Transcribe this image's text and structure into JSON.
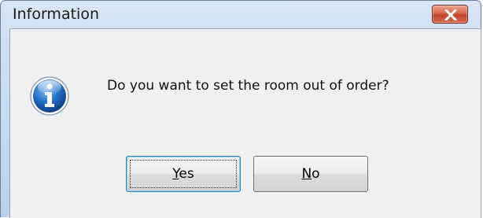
{
  "window": {
    "title": "Information"
  },
  "dialog": {
    "message": "Do you want to set the room out of order?",
    "icon": "info-icon"
  },
  "buttons": {
    "yes": {
      "mnemonic": "Y",
      "rest": "es"
    },
    "no": {
      "mnemonic": "N",
      "rest": "o"
    }
  },
  "colors": {
    "titlebar": "#c9dbef",
    "close_button": "#c3422b",
    "client_background": "#f0f0f0",
    "info_icon": "#1a5fb4"
  }
}
